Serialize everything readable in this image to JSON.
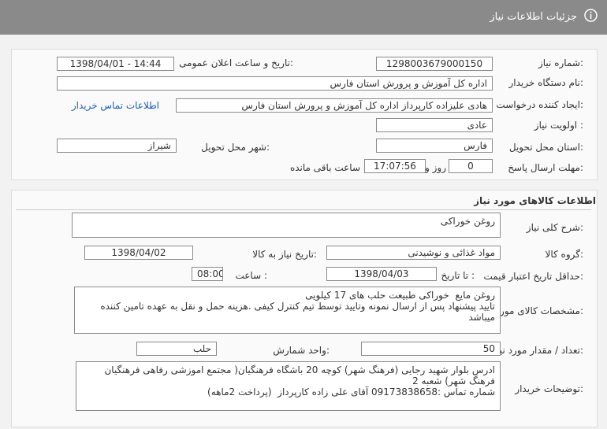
{
  "header": {
    "title": "جزئیات اطلاعات نیاز",
    "icon": "info-icon"
  },
  "need_info": {
    "need_number_label": "شماره نیاز:",
    "need_number": "1298003679000150",
    "announce_label": "تاریخ و ساعت اعلان عمومی:",
    "announce_value": "1398/04/01 - 14:44",
    "buyer_org_label": "نام دستگاه خریدار:",
    "buyer_org": "اداره کل آموزش و پرورش استان فارس",
    "requester_label": "ایجاد کننده درخواست:",
    "requester": "هادی علیزاده کارپرداز اداره کل آموزش و پرورش استان فارس",
    "contact_link": "اطلاعات تماس خریدار",
    "priority_label": "اولویت نیاز :",
    "priority": "عادی",
    "province_label": "استان محل تحویل:",
    "province": "فارس",
    "city_label": "شهر محل تحویل:",
    "city": "شیراز",
    "deadline_label": "مهلت ارسال پاسخ:",
    "deadline_days": "0",
    "days_label": "روز و",
    "deadline_time": "17:07:56",
    "remaining_label": "ساعت باقی مانده"
  },
  "goods": {
    "section_title": "اطلاعات کالاهای مورد نیاز",
    "general_desc_label": "شرح کلی نیاز:",
    "general_desc": "روغن خوراکی",
    "group_label": "گروه کالا:",
    "group": "مواد غذائی و نوشیدنی",
    "need_date_label": "تاریخ نیاز به کالا:",
    "need_date": "1398/04/02",
    "min_validity_label": "حداقل تاریخ اعتبار قیمت:",
    "to_date_label": "تا تاریخ :",
    "to_date": "1398/04/03",
    "time_label": "ساعت :",
    "time": "08:00",
    "specs_label": "مشخصات کالای مورد نیاز:",
    "specs_lines": [
      "روغن مایع  خوراکی طبیعت حلب های 17 کیلویی",
      "تایید پیشنهاد پس از ارسال نمونه وتایید توسط تیم کنترل کیفی .هزینه حمل و نقل به عهده تامین کننده",
      "میباشد"
    ],
    "quantity_label": "تعداد / مقدار مورد نیاز:",
    "quantity": "50",
    "unit_label": "واحد شمارش:",
    "unit": "حلب",
    "buyer_notes_label": "توضیحات خریدار:",
    "buyer_notes_lines": [
      "ادرس بلوار شهید رجایی (فرهنگ شهر) کوچه 20 باشگاه فرهنگیان( مجتمع اموزشی رفاهی فرهنگیان",
      "فرهنگ شهر) شعبه 2",
      "شماره تماس :09173838658 آقای علی زاده کارپرداز  (پرداخت 2ماهه)"
    ]
  }
}
